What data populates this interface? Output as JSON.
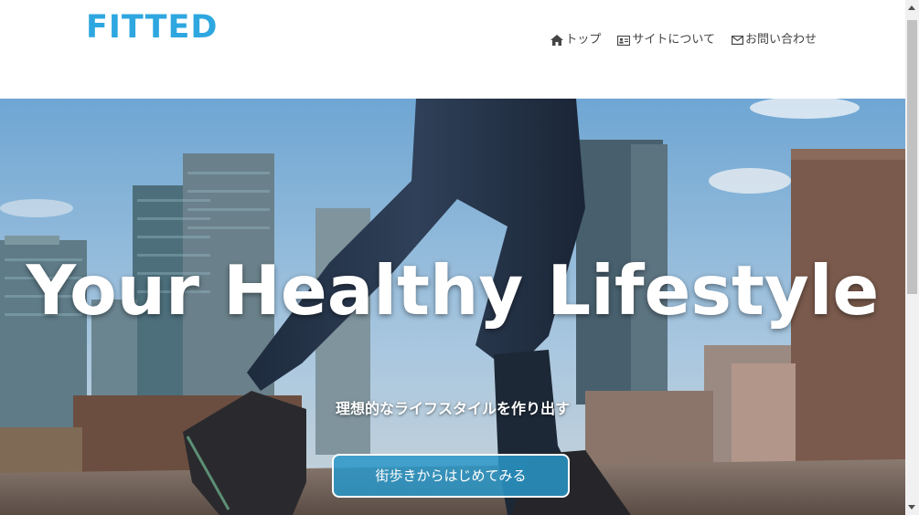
{
  "site": {
    "logo": "FITTED"
  },
  "nav": {
    "items": [
      {
        "label": "トップ",
        "icon": "home-icon"
      },
      {
        "label": "サイトについて",
        "icon": "id-card-icon"
      },
      {
        "label": "お問い合わせ",
        "icon": "envelope-icon"
      }
    ]
  },
  "hero": {
    "headline": "Your Healthy Lifestyle",
    "subtitle": "理想的なライフスタイルを作り出す",
    "cta_label": "街歩きからはじめてみる",
    "background": "city-rooftop-walking-photo"
  },
  "colors": {
    "brand": "#2ea7e0",
    "nav_text": "#444444",
    "cta_bg": "#2996c8"
  }
}
